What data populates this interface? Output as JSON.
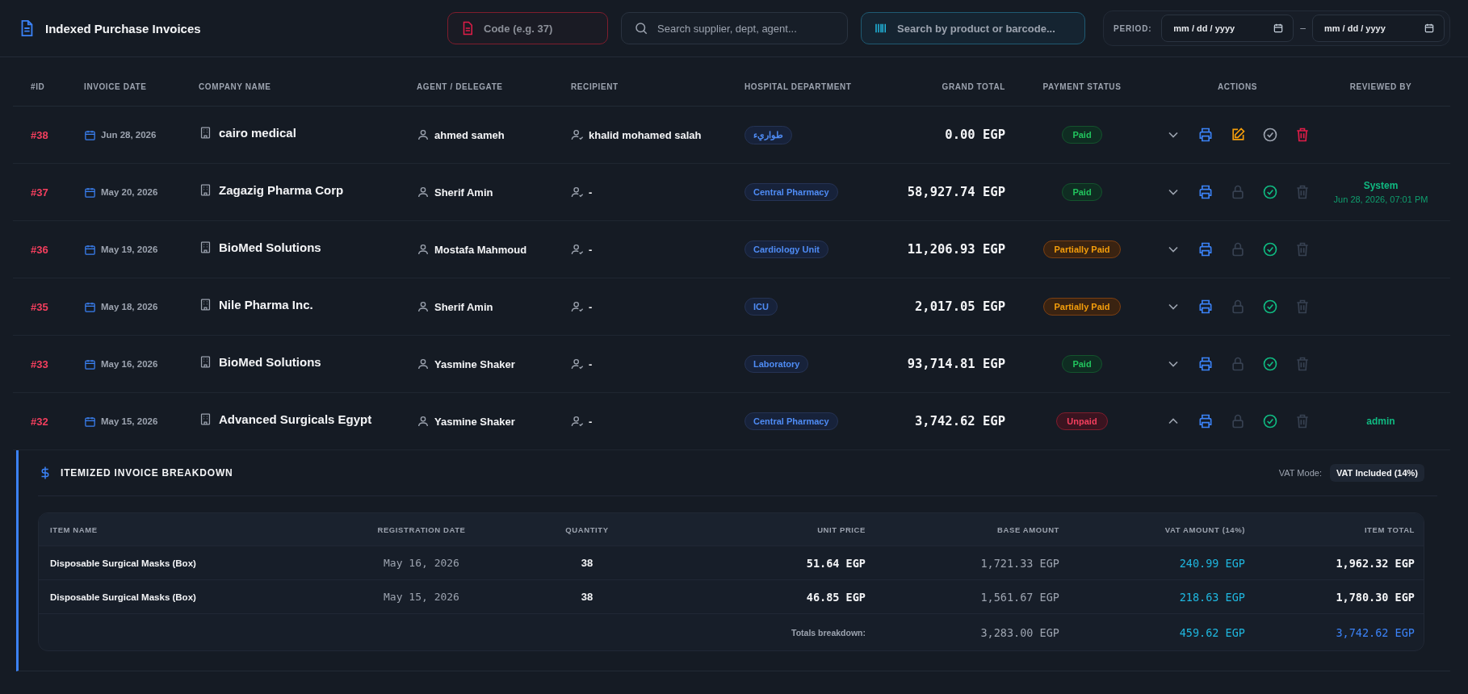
{
  "header": {
    "title": "Indexed Purchase Invoices",
    "code_search": {
      "placeholder": "Code (e.g. 37)"
    },
    "search": {
      "placeholder": "Search supplier, dept, agent..."
    },
    "barcode_search": {
      "placeholder": "Search by product or barcode..."
    },
    "period": {
      "label": "PERIOD:",
      "from": {
        "placeholder": "mm / dd / yyyy"
      },
      "separator": "–",
      "to": {
        "placeholder": "mm / dd / yyyy"
      }
    }
  },
  "table": {
    "columns": [
      "#ID",
      "INVOICE DATE",
      "COMPANY NAME",
      "AGENT / DELEGATE",
      "RECIPIENT",
      "HOSPITAL DEPARTMENT",
      "GRAND TOTAL",
      "PAYMENT STATUS",
      "ACTIONS",
      "REVIEWED BY"
    ],
    "rows": [
      {
        "id": "#38",
        "date": "Jun 28, 2026",
        "company": "cairo medical",
        "agent": "ahmed sameh",
        "recipient": "khalid mohamed salah",
        "department": "طواريء",
        "total": "0.00 EGP",
        "status": {
          "label": "Paid",
          "kind": "paid"
        },
        "expanded": false,
        "approved": false
      },
      {
        "id": "#37",
        "date": "May 20, 2026",
        "company": "Zagazig Pharma Corp",
        "agent": "Sherif Amin",
        "recipient": "-",
        "department": "Central Pharmacy",
        "total": "58,927.74 EGP",
        "status": {
          "label": "Paid",
          "kind": "paid"
        },
        "expanded": false,
        "approved": true,
        "reviewer": {
          "name": "System",
          "time": "Jun 28, 2026, 07:01 PM"
        }
      },
      {
        "id": "#36",
        "date": "May 19, 2026",
        "company": "BioMed Solutions",
        "agent": "Mostafa Mahmoud",
        "recipient": "-",
        "department": "Cardiology Unit",
        "total": "11,206.93 EGP",
        "status": {
          "label": "Partially Paid",
          "kind": "partial"
        },
        "expanded": false,
        "approved": true
      },
      {
        "id": "#35",
        "date": "May 18, 2026",
        "company": "Nile Pharma Inc.",
        "agent": "Sherif Amin",
        "recipient": "-",
        "department": "ICU",
        "total": "2,017.05 EGP",
        "status": {
          "label": "Partially Paid",
          "kind": "partial"
        },
        "expanded": false,
        "approved": true
      },
      {
        "id": "#33",
        "date": "May 16, 2026",
        "company": "BioMed Solutions",
        "agent": "Yasmine Shaker",
        "recipient": "-",
        "department": "Laboratory",
        "total": "93,714.81 EGP",
        "status": {
          "label": "Paid",
          "kind": "paid"
        },
        "expanded": false,
        "approved": true
      },
      {
        "id": "#32",
        "date": "May 15, 2026",
        "company": "Advanced Surgicals Egypt",
        "agent": "Yasmine Shaker",
        "recipient": "-",
        "department": "Central Pharmacy",
        "total": "3,742.62 EGP",
        "status": {
          "label": "Unpaid",
          "kind": "unpaid"
        },
        "expanded": true,
        "approved": true,
        "reviewer": {
          "name": "admin"
        }
      }
    ]
  },
  "breakdown": {
    "title": "ITEMIZED INVOICE BREAKDOWN",
    "vat_mode_label": "VAT Mode:",
    "vat_mode": "VAT Included (14%)",
    "columns": [
      "ITEM NAME",
      "REGISTRATION DATE",
      "QUANTITY",
      "UNIT PRICE",
      "BASE AMOUNT",
      "VAT AMOUNT (14%)",
      "ITEM TOTAL"
    ],
    "rows": [
      {
        "item": "Disposable Surgical Masks (Box)",
        "date": "May 16, 2026",
        "quantity": "38",
        "unit_price": "51.64 EGP",
        "base": "1,721.33 EGP",
        "vat": "240.99 EGP",
        "total": "1,962.32 EGP"
      },
      {
        "item": "Disposable Surgical Masks (Box)",
        "date": "May 15, 2026",
        "quantity": "38",
        "unit_price": "46.85 EGP",
        "base": "1,561.67 EGP",
        "vat": "218.63 EGP",
        "total": "1,780.30 EGP"
      }
    ],
    "totals": {
      "label": "Totals breakdown:",
      "base": "3,283.00 EGP",
      "vat": "459.62 EGP",
      "total": "3,742.62 EGP"
    }
  }
}
